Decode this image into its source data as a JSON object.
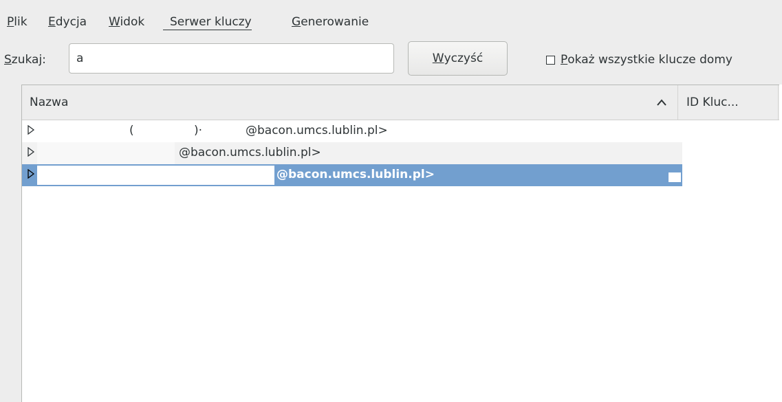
{
  "menubar": {
    "items": [
      {
        "mnemonic": "P",
        "rest": "lik"
      },
      {
        "mnemonic": "E",
        "rest": "dycja"
      },
      {
        "mnemonic": "W",
        "rest": "idok"
      },
      {
        "mnemonic": "S",
        "rest": "erwer kluczy"
      },
      {
        "mnemonic": "G",
        "rest": "enerowanie"
      }
    ]
  },
  "search": {
    "label_mnemonic": "S",
    "label_rest": "zukaj:",
    "value": "a",
    "clear_mnemonic": "W",
    "clear_rest": "yczyść",
    "show_all_mnemonic": "P",
    "show_all_rest": "okaż wszystkie klucze domy"
  },
  "table": {
    "columns": [
      "Nazwa",
      "ID Kluc..."
    ],
    "sort_icon": "chevron-up-icon",
    "rows": [
      {
        "segments": [
          "(",
          ")·",
          "@bacon.umcs.lublin.pl>"
        ],
        "selected": false
      },
      {
        "segments": [
          "@bacon.umcs.lublin.pl>"
        ],
        "selected": false
      },
      {
        "segments": [
          "@bacon.umcs.lublin.pl>"
        ],
        "selected": true
      }
    ]
  },
  "colors": {
    "selection": "#729fcf",
    "window_bg": "#ededed",
    "list_bg": "#ffffff"
  }
}
